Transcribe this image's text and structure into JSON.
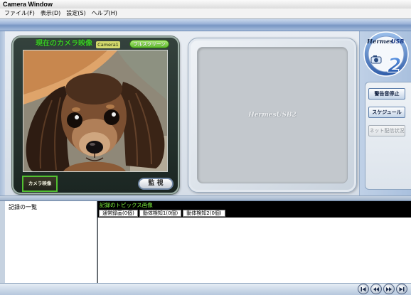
{
  "window": {
    "title": "Camera Window"
  },
  "menu": [
    {
      "label": "ファイル(F)"
    },
    {
      "label": "表示(D)"
    },
    {
      "label": "設定(S)"
    },
    {
      "label": "ヘルプ(H)"
    }
  ],
  "camera_panel": {
    "title": "現在のカメラ映像",
    "camera_name": "Camera1",
    "fullscreen_label": "フルスクリーン",
    "camera_view_label": "カメラ映像",
    "monitor_label": "監 視"
  },
  "preview_panel": {
    "watermark": "HermesUSB2"
  },
  "logo": {
    "brand": "Hermes",
    "product": "USB",
    "version": "2"
  },
  "side_buttons": [
    {
      "label": "警告音停止",
      "enabled": true
    },
    {
      "label": "スケジュール",
      "enabled": true
    },
    {
      "label": "ネット配信状況",
      "enabled": false
    }
  ],
  "records": {
    "list_title": "記録の一覧",
    "topics_title": "記録のトピックス画像",
    "tabs": [
      {
        "label": "通常録画(0個)"
      },
      {
        "label": "動体検知1(0個)"
      },
      {
        "label": "動体検知2(0個)"
      }
    ]
  },
  "nav_buttons": [
    {
      "icon": "skip-to-first-icon"
    },
    {
      "icon": "rewind-icon"
    },
    {
      "icon": "fast-forward-icon"
    },
    {
      "icon": "skip-to-last-icon"
    }
  ],
  "colors": {
    "camera_title": "#3ccc28",
    "fullscreen_button": "#5cb82c",
    "camera_view_border": "#52c030",
    "topics_title": "#7cf03c",
    "topics_header_bg": "#000000",
    "header_band": "#7896c4"
  }
}
